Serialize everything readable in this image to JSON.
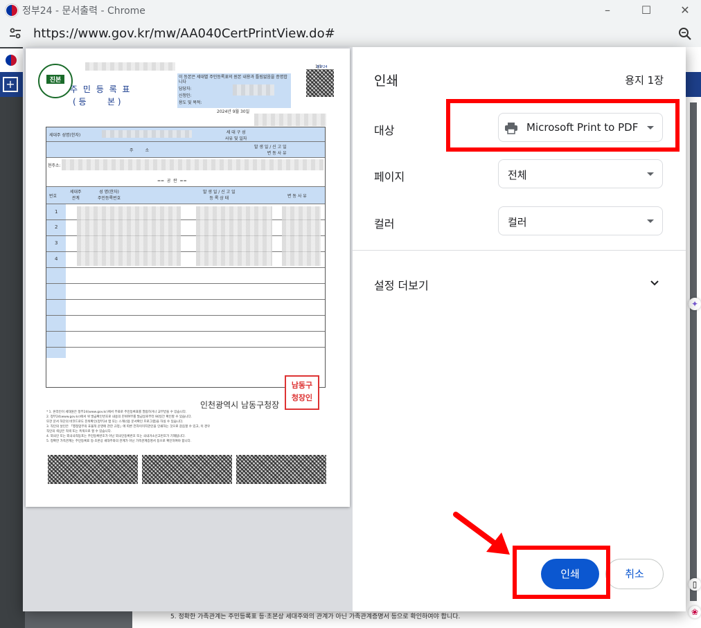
{
  "window": {
    "title": "정부24 - 문서출력 - Chrome"
  },
  "address": {
    "url": "https://www.gov.kr/mw/AA040CertPrintView.do#"
  },
  "dialog": {
    "heading": "인쇄",
    "sheet_count": "용지 1장",
    "destination": {
      "label": "대상",
      "value": "Microsoft Print to PDF"
    },
    "pages": {
      "label": "페이지",
      "value": "전체"
    },
    "color": {
      "label": "컬러",
      "value": "컬러"
    },
    "more_settings": "설정 더보기",
    "print_button": "인쇄",
    "cancel_button": "취소"
  },
  "document": {
    "page_no": "1/1",
    "title_line1": "주 민 등 록 표",
    "title_line2": "( 등        본 )",
    "stamp_text": "진본",
    "logo_text": "정부24",
    "notice": "이 등본은 세대별 주민등록표의 원본 내용과 틀림없음을 증명합니다",
    "officer": "담당자:",
    "applicant": "신청인:",
    "purpose": "용도 및 목적:",
    "date": "2024년 9월 30일",
    "head_of_household": "세대주 성명(한자)",
    "household_reason": "세 대 구 성\n사유 및 일자",
    "address_header": "주         소",
    "report_header": "발 생 일 / 신 고 일\n변 동 사 유",
    "current_address": "현주소:",
    "blank": "==  공  란  ==",
    "col_no": "번호",
    "col_relation": "세대주\n관계",
    "col_name": "성 명(한자)\n주민등록번호",
    "col_report": "발 생 일 / 신 고 일\n등 록 상 태",
    "col_reason": "변 동 사 유",
    "row_numbers": [
      "1",
      "2",
      "3",
      "4"
    ],
    "issuer": "인천광역시 남동구청장",
    "seal_text": "남동구\n청장인",
    "footer_notes": [
      "* 1. 온라인이 세대원은 정부24(www.gov.kr)에서 무료로 주민등록표를 열람하거나 교부받을 수 있습니다.",
      "2. 정부24(www.gov.kr)에서 위 발급확인번호로 내용의 진위여부를 발급일로부터 90일간 확인할 수 있습니다.",
      "또한 문서 하단의 바코드로도 진위확인(정부24 앱 또는 스캐너용 문서확인 프로그램)을 하실 수 있습니다.",
      "3. 직인의 날인은 「행정업무의 효율적 운영에 관한 규정」에 따른 전자이미지관인을 인쇄하는 것으로 갈음할 수 있고, 이 경우",
      "직인의 색상은 적색 또는 흑색으로 할 수 있습니다.",
      "4. 외국인 또는 외국국적동포는 주민등록번호가 아닌 외국인등록번호 또는 국내거소신고번호가 기재됩니다.",
      "5. 정확한 가족관계는 주민등록표 등·초본상 세대주와의 관계가 아닌 가족관계증명서 등으로 확인하여야 합니다."
    ]
  },
  "background_footer": "5. 정확한 가족관계는 주민등록표 등·초본상 세대주와의 관계가 아닌 가족관계증명서 등으로 확인하여야 합니다.",
  "colors": {
    "accent": "#0b57d0",
    "annotation": "#ff0000",
    "table_header": "#c8ddf5"
  }
}
